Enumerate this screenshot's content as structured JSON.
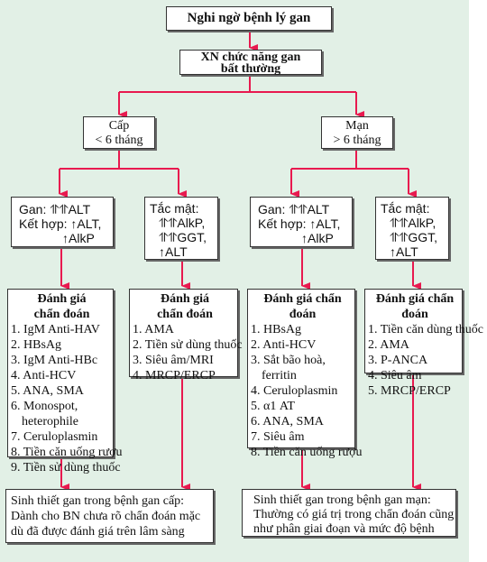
{
  "title": "Nghi ngờ bệnh lý gan",
  "abnormal": {
    "line1": "XN chức năng gan",
    "line2": "bất thường"
  },
  "acute": {
    "line1": "Cấp",
    "line2": "< 6 tháng"
  },
  "chronic": {
    "line1": "Mạn",
    "line2": "> 6 tháng"
  },
  "pattern_hepatic": {
    "line1": "Gan: ⥣⥣ALT",
    "line2": "Kết hợp: ↑ALT,",
    "line3": "↑AlkP"
  },
  "pattern_cholestatic": {
    "line1": "Tắc mật:",
    "line2": "⥣⥣AlkP,",
    "line3": "⥣⥣GGT,",
    "line4": "↑ALT"
  },
  "eval_acute_hepatic": {
    "heading1": "Đánh giá",
    "heading2": "chẩn đoán",
    "items": [
      "1. IgM Anti-HAV",
      "2. HBsAg",
      "3. IgM Anti-HBc",
      "4. Anti-HCV",
      "5. ANA, SMA",
      "6. Monospot,",
      "heterophile",
      "7. Ceruloplasmin",
      "8. Tiền căn uống rượu",
      "9. Tiền sử dùng thuốc"
    ]
  },
  "eval_acute_cholestatic": {
    "heading1": "Đánh giá",
    "heading2": "chẩn đoán",
    "items": [
      "1. AMA",
      "2. Tiền sử dùng thuốc",
      "3. Siêu âm/MRI",
      "4. MRCP/ERCP"
    ]
  },
  "eval_chronic_hepatic": {
    "heading1": "Đánh giá chẩn",
    "heading2": "đoán",
    "items": [
      "1. HBsAg",
      "2. Anti-HCV",
      "3. Sắt bão hoà,",
      "ferritin",
      "4. Ceruloplasmin",
      "5. α1 AT",
      "6. ANA, SMA",
      "7. Siêu âm",
      "8. Tiền căn uống rượu"
    ]
  },
  "eval_chronic_cholestatic": {
    "heading1": "Đánh giá chẩn",
    "heading2": "đoán",
    "items": [
      "1. Tiền căn dùng thuốc",
      "2. AMA",
      "3. P-ANCA",
      "4. Siêu âm",
      "5. MRCP/ERCP"
    ]
  },
  "biopsy_acute": {
    "line1": "Sinh thiết gan trong bệnh gan cấp:",
    "line2": "Dành cho BN chưa rõ chẩn đoán mặc",
    "line3": "dù đã được đánh giá trên lâm sàng"
  },
  "biopsy_chronic": {
    "line1": "Sinh thiết gan trong bệnh gan mạn:",
    "line2": "Thường có giá trị trong chẩn đoán cũng",
    "line3": "như phân giai đoạn và mức độ bệnh"
  },
  "colors": {
    "background": "#e2f0e6",
    "arrow": "#e8194f",
    "box_border": "#333333"
  }
}
